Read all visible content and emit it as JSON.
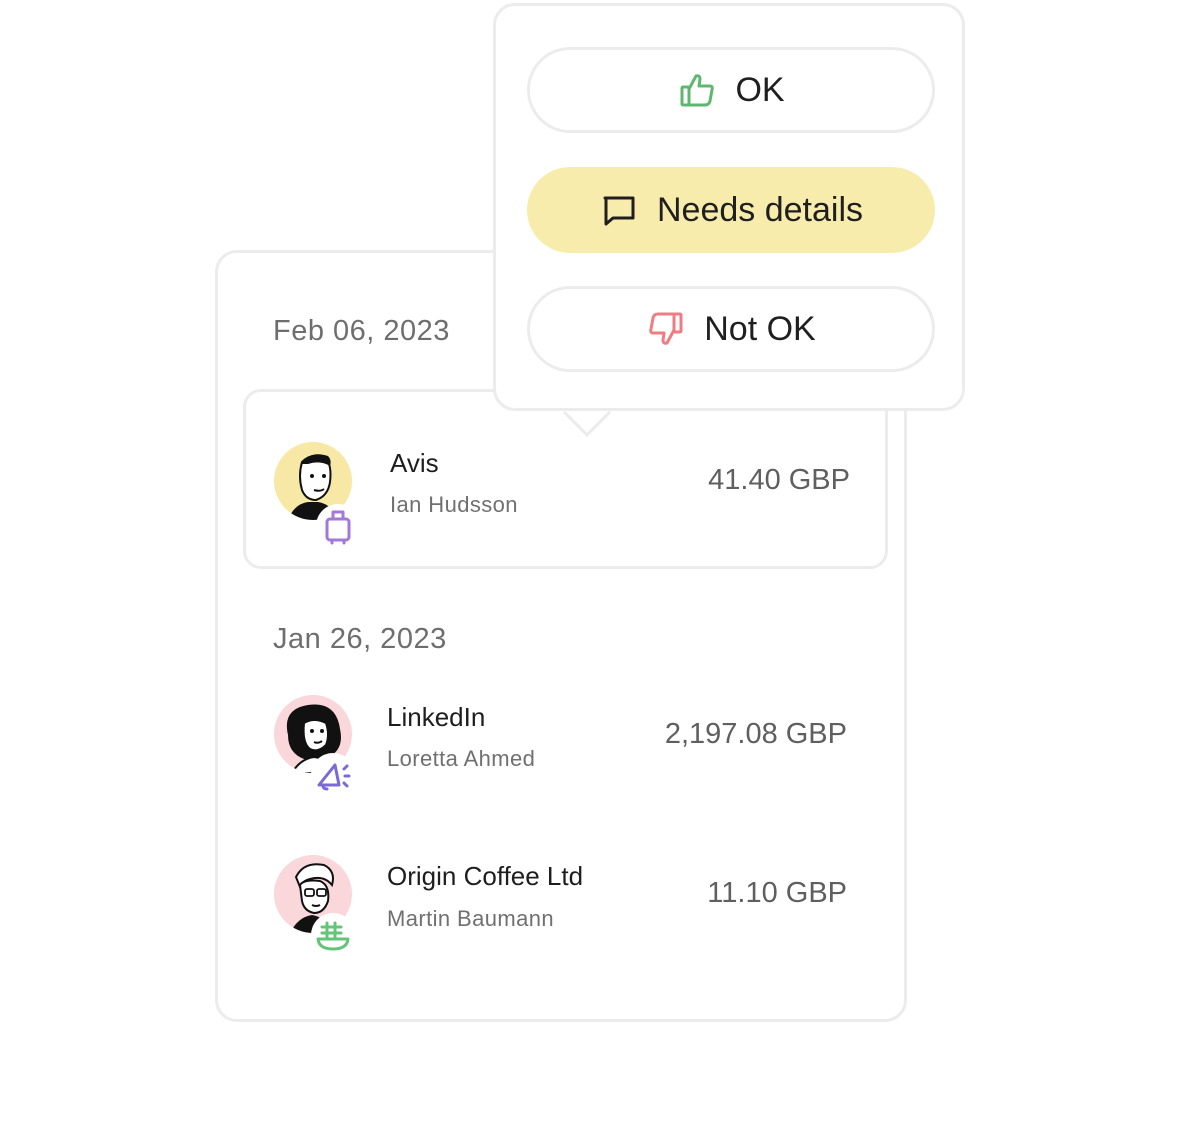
{
  "colors": {
    "ok_icon": "#5fb76f",
    "not_ok_icon": "#ef7c80",
    "needs_details_bg": "#f8ecad",
    "travel_icon": "#a378d8",
    "marketing_icon": "#7b6ad6",
    "food_icon": "#63c47a"
  },
  "groups": [
    {
      "date": "Feb 06, 2023",
      "transactions": [
        {
          "merchant": "Avis",
          "person": "Ian Hudsson",
          "amount": "41.40 GBP",
          "category_icon": "luggage-icon",
          "avatar_bg": "#f8e8a6"
        }
      ]
    },
    {
      "date": "Jan 26, 2023",
      "transactions": [
        {
          "merchant": "LinkedIn",
          "person": "Loretta Ahmed",
          "amount": "2,197.08 GBP",
          "category_icon": "megaphone-icon",
          "avatar_bg": "#f9d7da"
        },
        {
          "merchant": "Origin Coffee Ltd",
          "person": "Martin Baumann",
          "amount": "11.10 GBP",
          "category_icon": "food-bowl-icon",
          "avatar_bg": "#f9d7da"
        }
      ]
    }
  ],
  "review_menu": {
    "ok_label": "OK",
    "needs_details_label": "Needs details",
    "not_ok_label": "Not OK"
  }
}
